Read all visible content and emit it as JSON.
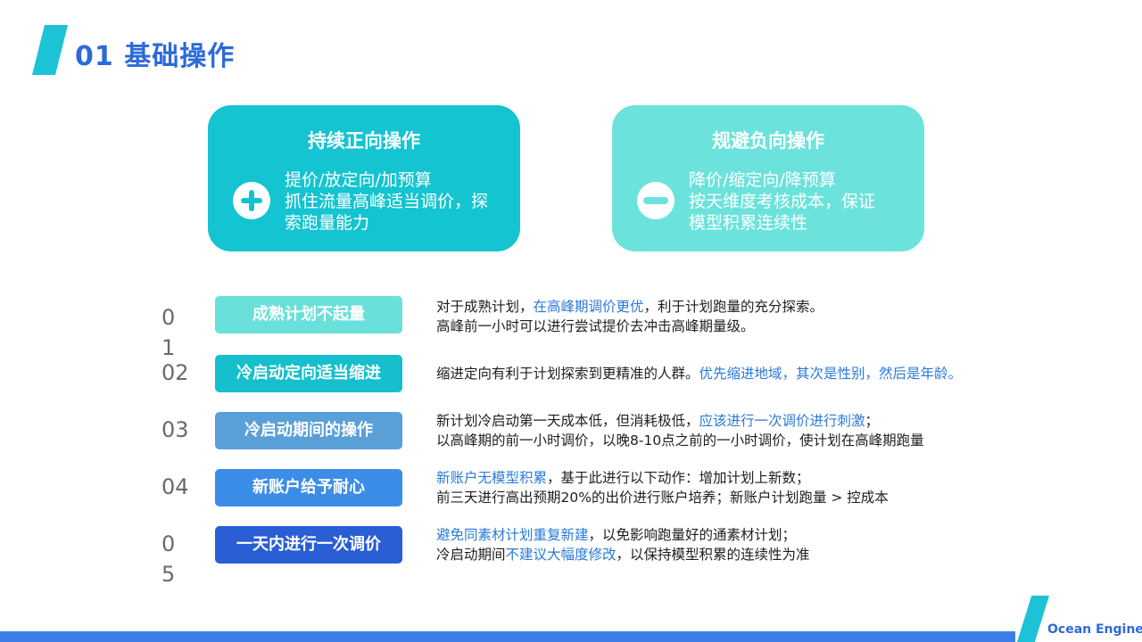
{
  "page": {
    "title": "01 基础操作"
  },
  "cards": [
    {
      "title": "持续正向操作",
      "icon": "plus-icon",
      "lines": [
        "提价/放定向/加预算",
        "抓住流量高峰适当调价，探",
        "索跑量能力"
      ]
    },
    {
      "title": "规避负向操作",
      "icon": "minus-icon",
      "lines": [
        "降价/缩定向/降预算",
        "按天维度考核成本，保证",
        "模型积累连续性"
      ]
    }
  ],
  "rows": [
    {
      "num": [
        "0",
        "1"
      ],
      "tag": "成熟计划不起量",
      "tag_color": "#6ae0da",
      "desc": [
        [
          {
            "t": "对于成熟计划，",
            "hl": false
          },
          {
            "t": "在高峰期调价更优",
            "hl": true
          },
          {
            "t": "，利于计划跑量的充分探索。",
            "hl": false
          }
        ],
        [
          {
            "t": "高峰前一小时可以进行尝试提价去冲击高峰期量级。",
            "hl": false
          }
        ]
      ]
    },
    {
      "num": [
        "02"
      ],
      "tag": "冷启动定向适当缩进",
      "tag_color": "#15bfcc",
      "desc": [
        [
          {
            "t": "缩进定向有利于计划探索到更精准的人群。",
            "hl": false
          },
          {
            "t": "优先缩进地域，其次是性别，然后是年龄。",
            "hl": true
          }
        ]
      ]
    },
    {
      "num": [
        "03"
      ],
      "tag": "冷启动期间的操作",
      "tag_color": "#5aa0d8",
      "desc": [
        [
          {
            "t": "新计划冷启动第一天成本低，但消耗极低，",
            "hl": false
          },
          {
            "t": "应该进行一次调价进行刺激",
            "hl": true
          },
          {
            "t": "；",
            "hl": false
          }
        ],
        [
          {
            "t": "以高峰期的前一小时调价，以晚8-10点之前的一小时调价，使计划在高峰期跑量",
            "hl": false
          }
        ]
      ]
    },
    {
      "num": [
        "04"
      ],
      "tag": "新账户给予耐心",
      "tag_color": "#3c8de8",
      "desc": [
        [
          {
            "t": "新账户无模型积累",
            "hl": true
          },
          {
            "t": "，基于此进行以下动作：增加计划上新数；",
            "hl": false
          }
        ],
        [
          {
            "t": "前三天进行高出预期20%的出价进行账户培养；新账户计划跑量 > 控成本",
            "hl": false
          }
        ]
      ]
    },
    {
      "num": [
        "0",
        "5"
      ],
      "tag": "一天内进行一次调价",
      "tag_color": "#2a5ed4",
      "desc": [
        [
          {
            "t": "避免同素材计划重复新建",
            "hl": true
          },
          {
            "t": "，以免影响跑量好的通素材计划；",
            "hl": false
          }
        ],
        [
          {
            "t": "冷启动期间",
            "hl": false
          },
          {
            "t": "不建议大幅度修改",
            "hl": true
          },
          {
            "t": "，以保持模型积累的连续性为准",
            "hl": false
          }
        ]
      ]
    }
  ],
  "footer": {
    "logo": "Ocean Engine"
  }
}
